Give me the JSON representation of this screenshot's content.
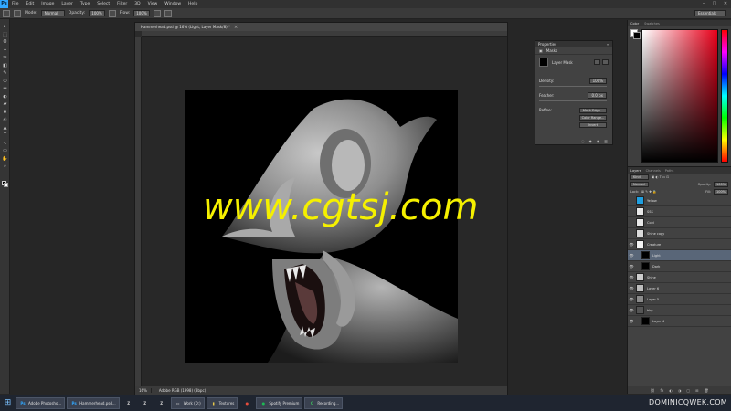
{
  "app": {
    "logo": "Ps",
    "menu": [
      "File",
      "Edit",
      "Image",
      "Layer",
      "Type",
      "Select",
      "Filter",
      "3D",
      "View",
      "Window",
      "Help"
    ],
    "window_controls": [
      "–",
      "□",
      "✕"
    ]
  },
  "options_bar": {
    "mode_label": "Mode:",
    "mode_value": "Normal",
    "opacity_label": "Opacity:",
    "opacity_value": "100%",
    "flow_label": "Flow:",
    "flow_value": "100%",
    "workspace": "Essentials"
  },
  "tools": [
    "▸",
    "⬚",
    "ʘ",
    "⌖",
    "✂",
    "◧",
    "✎",
    "⎔",
    "✚",
    "◐",
    "▰",
    "⬮",
    "✍",
    "▲",
    "T",
    "↖",
    "▭",
    "✋",
    "⌕",
    "⋯"
  ],
  "document": {
    "tab_title": "Hammerhead.psd @ 16% (Light, Layer Mask/8) *",
    "close": "×",
    "zoom": "16%",
    "info": "Adobe RGB (1998) (8bpc)"
  },
  "properties": {
    "title": "Properties",
    "section_label": "Masks",
    "mask_label": "Layer Mask",
    "density_label": "Density:",
    "density_value": "100%",
    "feather_label": "Feather:",
    "feather_value": "0.0 px",
    "refine_label": "Refine:",
    "buttons": [
      "Mask Edge...",
      "Color Range...",
      "Invert"
    ]
  },
  "color_panel": {
    "tabs": [
      "Color",
      "Swatches"
    ],
    "accent_red": "#e8001a"
  },
  "layers_panel": {
    "tabs": [
      "Layers",
      "Channels",
      "Paths"
    ],
    "kind_label": "Kind",
    "blend_mode": "Normal",
    "opacity_label": "Opacity:",
    "opacity_value": "100%",
    "lock_label": "Lock:",
    "fill_label": "Fill:",
    "fill_value": "100%",
    "layers": [
      {
        "name": "Yellow",
        "thumb": "#1f9fe0",
        "selected": false,
        "visible": false,
        "indent": 0
      },
      {
        "name": "SSS",
        "thumb": "#e8e8e8",
        "selected": false,
        "visible": false,
        "indent": 0
      },
      {
        "name": "Cold",
        "thumb": "#e8e8e8",
        "selected": false,
        "visible": false,
        "indent": 0
      },
      {
        "name": "Shine copy",
        "thumb": "#dadada",
        "selected": false,
        "visible": false,
        "indent": 0
      },
      {
        "name": "Creature",
        "thumb": "#f2f2f2",
        "selected": false,
        "visible": true,
        "indent": 0
      },
      {
        "name": "Light",
        "thumb": "#000000",
        "selected": true,
        "visible": true,
        "indent": 1
      },
      {
        "name": "Dark",
        "thumb": "#000000",
        "selected": false,
        "visible": true,
        "indent": 1
      },
      {
        "name": "Shine",
        "thumb": "#cccccc",
        "selected": false,
        "visible": true,
        "indent": 0
      },
      {
        "name": "Layer 6",
        "thumb": "#bdbdbd",
        "selected": false,
        "visible": true,
        "indent": 0
      },
      {
        "name": "Layer 5",
        "thumb": "#8a8a8a",
        "selected": false,
        "visible": true,
        "indent": 0
      },
      {
        "name": "bkg",
        "thumb": "#555555",
        "selected": false,
        "visible": true,
        "indent": 0
      },
      {
        "name": "Layer 4",
        "thumb": "#000000",
        "selected": false,
        "visible": true,
        "indent": 1
      }
    ],
    "footer_icons": [
      "⛓",
      "fx",
      "◐",
      "◑",
      "▢",
      "⊞",
      "🗑"
    ]
  },
  "taskbar": {
    "start": "⊞",
    "items": [
      {
        "icon": "Ps",
        "label": "Adobe Photosho...",
        "color": "#31a8ff",
        "plain": false
      },
      {
        "icon": "Ps",
        "label": "Hammerhead.psd...",
        "color": "#31a8ff",
        "plain": false
      },
      {
        "icon": "Z",
        "label": "",
        "color": "#cfcfcf",
        "plain": true
      },
      {
        "icon": "Z",
        "label": "",
        "color": "#cfcfcf",
        "plain": true
      },
      {
        "icon": "Z",
        "label": "",
        "color": "#cfcfcf",
        "plain": true
      },
      {
        "icon": "▭",
        "label": "Work (D:)",
        "color": "#cfcfcf",
        "plain": false
      },
      {
        "icon": "▮",
        "label": "Textures",
        "color": "#e8c84a",
        "plain": false
      },
      {
        "icon": "●",
        "label": "",
        "color": "#e74c3c",
        "plain": true
      },
      {
        "icon": "●",
        "label": "Spotify Premium",
        "color": "#1db954",
        "plain": false
      },
      {
        "icon": "C",
        "label": "Recording...",
        "color": "#3fbf5f",
        "plain": false
      }
    ],
    "watermark": "DOMINICQWEK.COM"
  },
  "watermark": "www.cgtsj.com"
}
